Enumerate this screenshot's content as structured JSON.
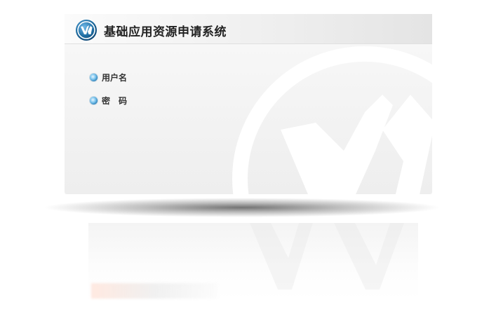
{
  "header": {
    "title": "基础应用资源申请系统",
    "logo_icon": "va-logo-icon"
  },
  "form": {
    "username_label": "用户名",
    "password_label": "密　码"
  },
  "colors": {
    "bullet": "#2a7fb8",
    "logo": "#1f6ea3"
  }
}
